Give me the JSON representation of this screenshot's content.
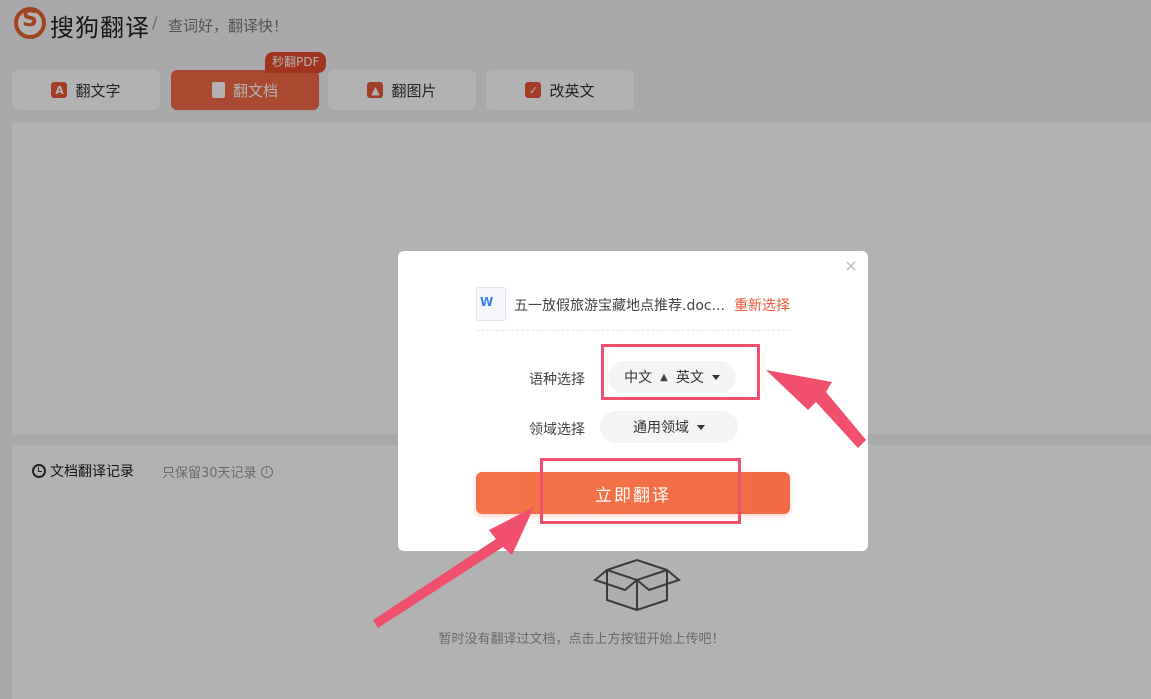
{
  "header": {
    "logo_text": "搜狗翻译",
    "separator": "/",
    "slogan": "查词好，翻译快！"
  },
  "tabs": [
    {
      "label": "翻文字",
      "icon": "text-translate-icon",
      "active": false
    },
    {
      "label": "翻文档",
      "icon": "document-icon",
      "active": true
    },
    {
      "label": "翻图片",
      "icon": "image-icon",
      "active": false
    },
    {
      "label": "改英文",
      "icon": "edit-english-icon",
      "active": false
    }
  ],
  "pdf_badge": "秒翻PDF",
  "history": {
    "title": "文档翻译记录",
    "note": "只保留30天记录",
    "empty_text": "暂时没有翻译过文档，点击上方按钮开始上传吧！"
  },
  "dialog": {
    "file_name": "五一放假旅游宝藏地点推荐.doc...",
    "reselect_label": "重新选择",
    "language_label": "语种选择",
    "source_lang": "中文",
    "target_lang": "英文",
    "domain_label": "领域选择",
    "domain_value": "通用领域",
    "translate_label": "立即翻译"
  },
  "colors": {
    "accent": "#f26a45",
    "annotation": "#f14f6e",
    "badge": "#e84a2c"
  }
}
